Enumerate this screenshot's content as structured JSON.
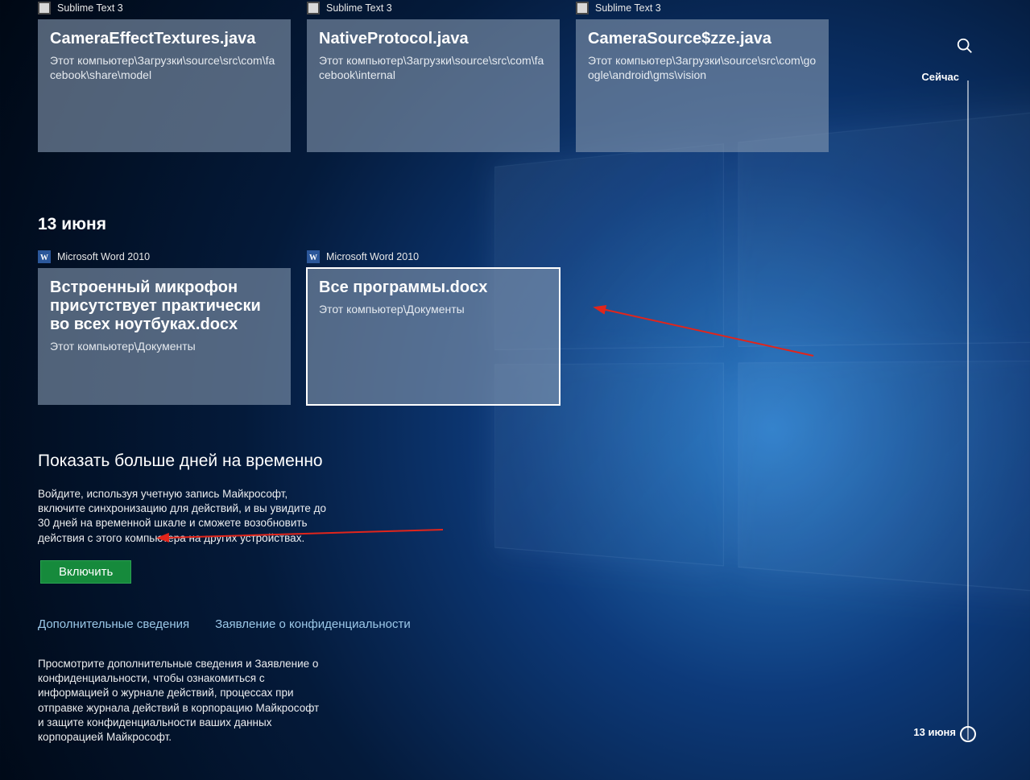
{
  "search": {
    "name": "search"
  },
  "timeline": {
    "top_label": "Сейчас",
    "bottom_label": "13 июня"
  },
  "row1": {
    "app_name": "Sublime Text 3",
    "cards": [
      {
        "title": "CameraEffectTextures.java",
        "path": "Этот компьютер\\Загрузки\\source\\src\\com\\facebook\\share\\model"
      },
      {
        "title": "NativeProtocol.java",
        "path": "Этот компьютер\\Загрузки\\source\\src\\com\\facebook\\internal"
      },
      {
        "title": "CameraSource$zze.java",
        "path": "Этот компьютер\\Загрузки\\source\\src\\com\\google\\android\\gms\\vision"
      }
    ]
  },
  "date_heading": "13 июня",
  "row2": {
    "app_name": "Microsoft Word 2010",
    "cards": [
      {
        "title": "Встроенный микрофон присутствует практически во всех ноутбуках.docx",
        "path": "Этот компьютер\\Документы"
      },
      {
        "title": "Все программы.docx",
        "path": "Этот компьютер\\Документы"
      }
    ]
  },
  "promo": {
    "title": "Показать больше дней на временно",
    "text": "Войдите, используя учетную запись Майкрософт, включите синхронизацию для действий, и вы увидите до 30 дней на временной шкале и сможете возобновить действия с этого компьютера на других устройствах.",
    "button": "Включить",
    "link_more": "Дополнительные сведения",
    "link_privacy": "Заявление о конфиденциальности",
    "footnote": "Просмотрите дополнительные сведения и Заявление о конфиденциальности, чтобы ознакомиться с информацией о журнале действий, процессах при отправке журнала действий в корпорацию Майкрософт и защите конфиденциальности ваших данных корпорацией Майкрософт."
  }
}
